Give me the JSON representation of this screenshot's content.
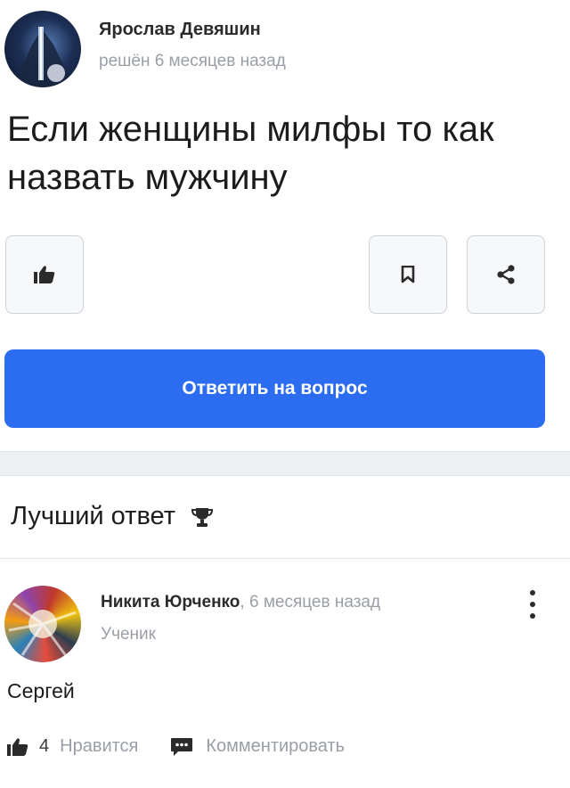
{
  "question": {
    "author": "Ярослав Девяшин",
    "meta": "решён 6 месяцев назад",
    "text": "Если женщины милфы то как назвать мужчину"
  },
  "actions": {
    "answer_button": "Ответить на вопрос"
  },
  "icons": {
    "like": "thumbs-up-icon",
    "bookmark": "bookmark-icon",
    "share": "share-icon",
    "trophy": "trophy-icon",
    "comment": "comment-icon",
    "more": "kebab-menu-icon"
  },
  "best_answer": {
    "title": "Лучший ответ",
    "author": "Никита Юрченко",
    "time": ", 6 месяцев назад",
    "rank": "Ученик",
    "text": "Сергей",
    "likes": "4",
    "like_label": "Нравится",
    "comment_label": "Комментировать"
  },
  "colors": {
    "accent": "#2b6cf0",
    "muted": "#9a9ea5",
    "text": "#1c1c1c"
  }
}
